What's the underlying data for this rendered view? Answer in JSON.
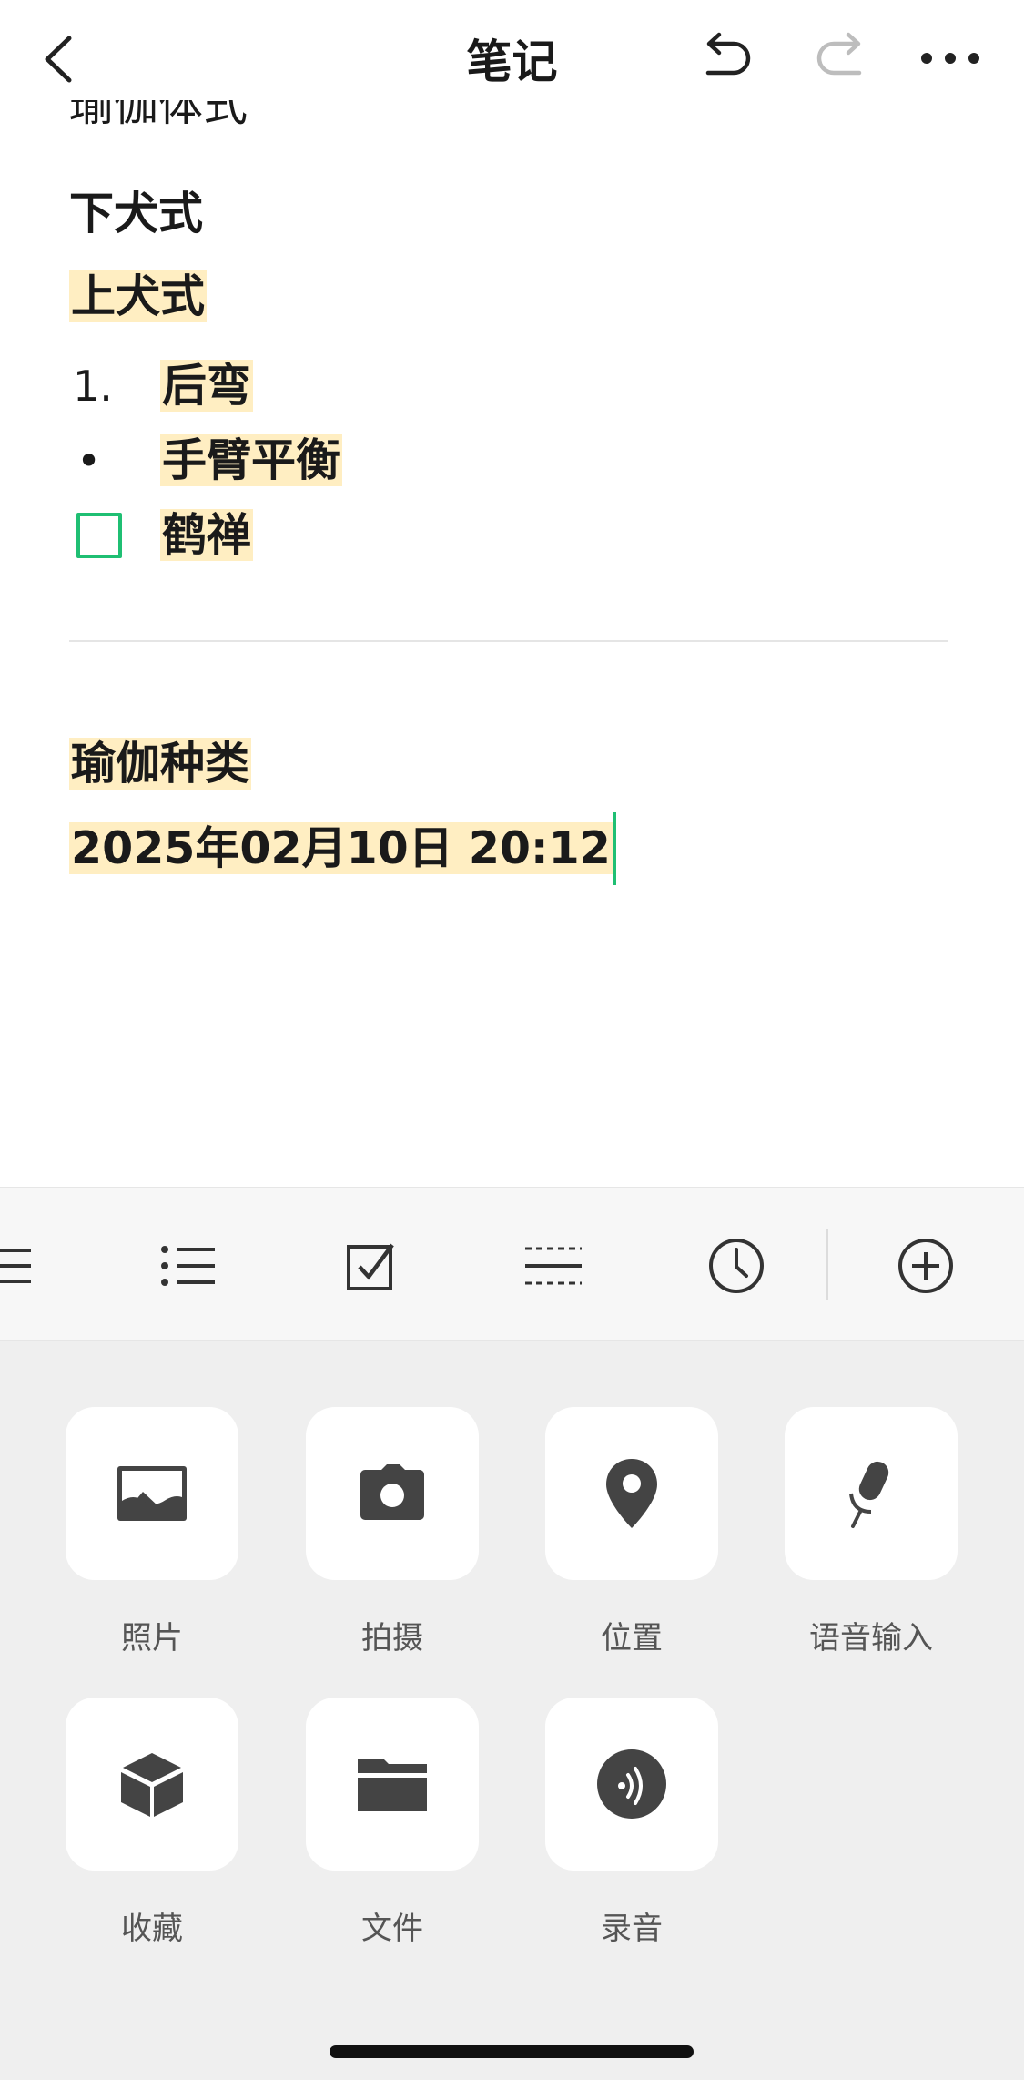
{
  "header": {
    "title": "笔记"
  },
  "editor": {
    "cut_line": "瑜伽体式",
    "line1": "下犬式",
    "line2": "上犬式",
    "numbered_marker": "1.",
    "numbered_item": "后弯",
    "bullet_marker": "•",
    "bullet_item": "手臂平衡",
    "checkbox_item": "鹤禅",
    "heading2": "瑜伽种类",
    "datetime": "2025年02月10日 20:12"
  },
  "panel": {
    "items": [
      {
        "label": "照片",
        "icon": "photo-icon"
      },
      {
        "label": "拍摄",
        "icon": "camera-icon"
      },
      {
        "label": "位置",
        "icon": "location-pin-icon"
      },
      {
        "label": "语音输入",
        "icon": "microphone-icon"
      },
      {
        "label": "收藏",
        "icon": "cube-icon"
      },
      {
        "label": "文件",
        "icon": "folder-icon"
      },
      {
        "label": "录音",
        "icon": "audio-record-icon"
      }
    ]
  },
  "colors": {
    "accent": "#1fbf73",
    "highlight": "#ffeec2",
    "panel_bg": "#efefef",
    "icon": "#444444",
    "disabled": "#bdbdbd"
  }
}
